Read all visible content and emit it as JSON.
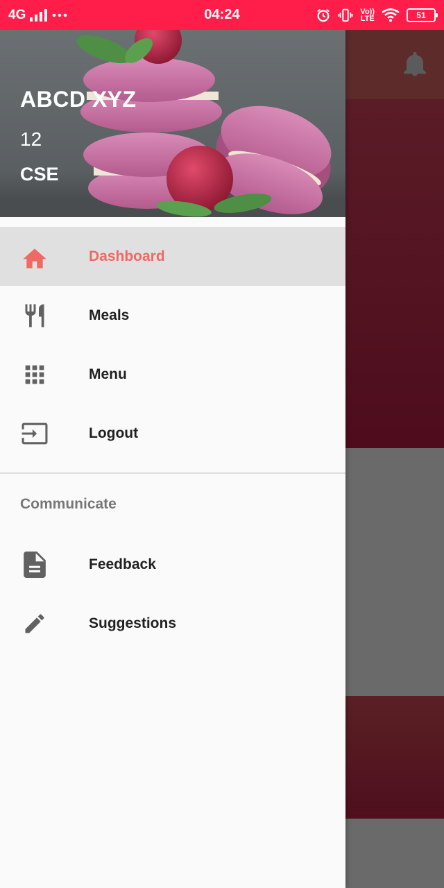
{
  "status_bar": {
    "network": "4G",
    "time": "04:24",
    "lte_top": "Vo))",
    "lte_bottom": "LTE",
    "battery": "51"
  },
  "drawer": {
    "header": {
      "name": "ABCD XYZ",
      "number": "12",
      "department": "CSE"
    },
    "primary_items": [
      {
        "label": "Dashboard",
        "icon": "home-icon",
        "active": true
      },
      {
        "label": "Meals",
        "icon": "restaurant-icon",
        "active": false
      },
      {
        "label": "Menu",
        "icon": "apps-grid-icon",
        "active": false
      },
      {
        "label": "Logout",
        "icon": "logout-icon",
        "active": false
      }
    ],
    "section_title": "Communicate",
    "secondary_items": [
      {
        "label": "Feedback",
        "icon": "document-icon"
      },
      {
        "label": "Suggestions",
        "icon": "pencil-icon"
      }
    ]
  },
  "colors": {
    "status_bar": "#ff1d4a",
    "active_accent": "#ef6a63",
    "active_bg": "#e0e0e0"
  }
}
